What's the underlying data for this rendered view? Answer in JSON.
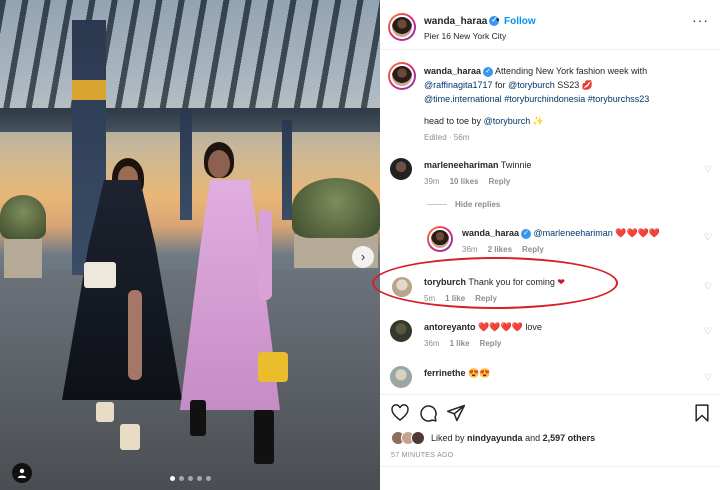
{
  "post": {
    "username": "wanda_haraa",
    "follow_label": "Follow",
    "location": "Pier 16 New York City",
    "more_label": "···",
    "caption": {
      "username": "wanda_haraa",
      "line1_text": "Attending New York fashion week with",
      "mention1": "@raffinagita1717",
      "for_text": "for",
      "mention2": "@toryburch",
      "tag_ss23": "SS23",
      "hearts": "💋",
      "mention3": "@time.international",
      "hashtag1": "#toryburchindonesia",
      "hashtag2": "#toryburchss23",
      "line3_prefix": "head to toe by",
      "mention4": "@toryburch",
      "sparkle": "✨",
      "edited": "Edited · 56m"
    }
  },
  "comments": [
    {
      "username": "marleneehariman",
      "text": "Twinnie",
      "time": "39m",
      "likes": "10 likes",
      "reply": "Reply"
    },
    {
      "username": "wanda_haraa",
      "mention": "@marleneehariman",
      "text": "❤️❤️❤️❤️",
      "time": "36m",
      "likes": "2 likes",
      "reply": "Reply"
    },
    {
      "username": "toryburch",
      "text": "Thank you for coming",
      "emoji": "❤",
      "time": "5m",
      "likes": "1 like",
      "reply": "Reply"
    },
    {
      "username": "antoreyanto",
      "text": "love",
      "emoji": "❤️❤️❤️❤️",
      "time": "36m",
      "likes": "1 like",
      "reply": "Reply"
    },
    {
      "username": "ferrinethe",
      "text": "😍😍",
      "time": "",
      "likes": "",
      "reply": ""
    }
  ],
  "hide_replies": "Hide replies",
  "liked_by": {
    "prefix": "Liked by",
    "user": "nindyayunda",
    "suffix": "and",
    "count": "2,597 others"
  },
  "posted_ago": "57 MINUTES AGO",
  "colors": {
    "accent": "#0095f6",
    "highlight": "#d61f26",
    "verified": "#3897f0"
  },
  "icons": [
    "heart-icon",
    "comment-icon",
    "share-icon",
    "bookmark-icon",
    "tag-person-icon",
    "chevron-right-icon"
  ]
}
